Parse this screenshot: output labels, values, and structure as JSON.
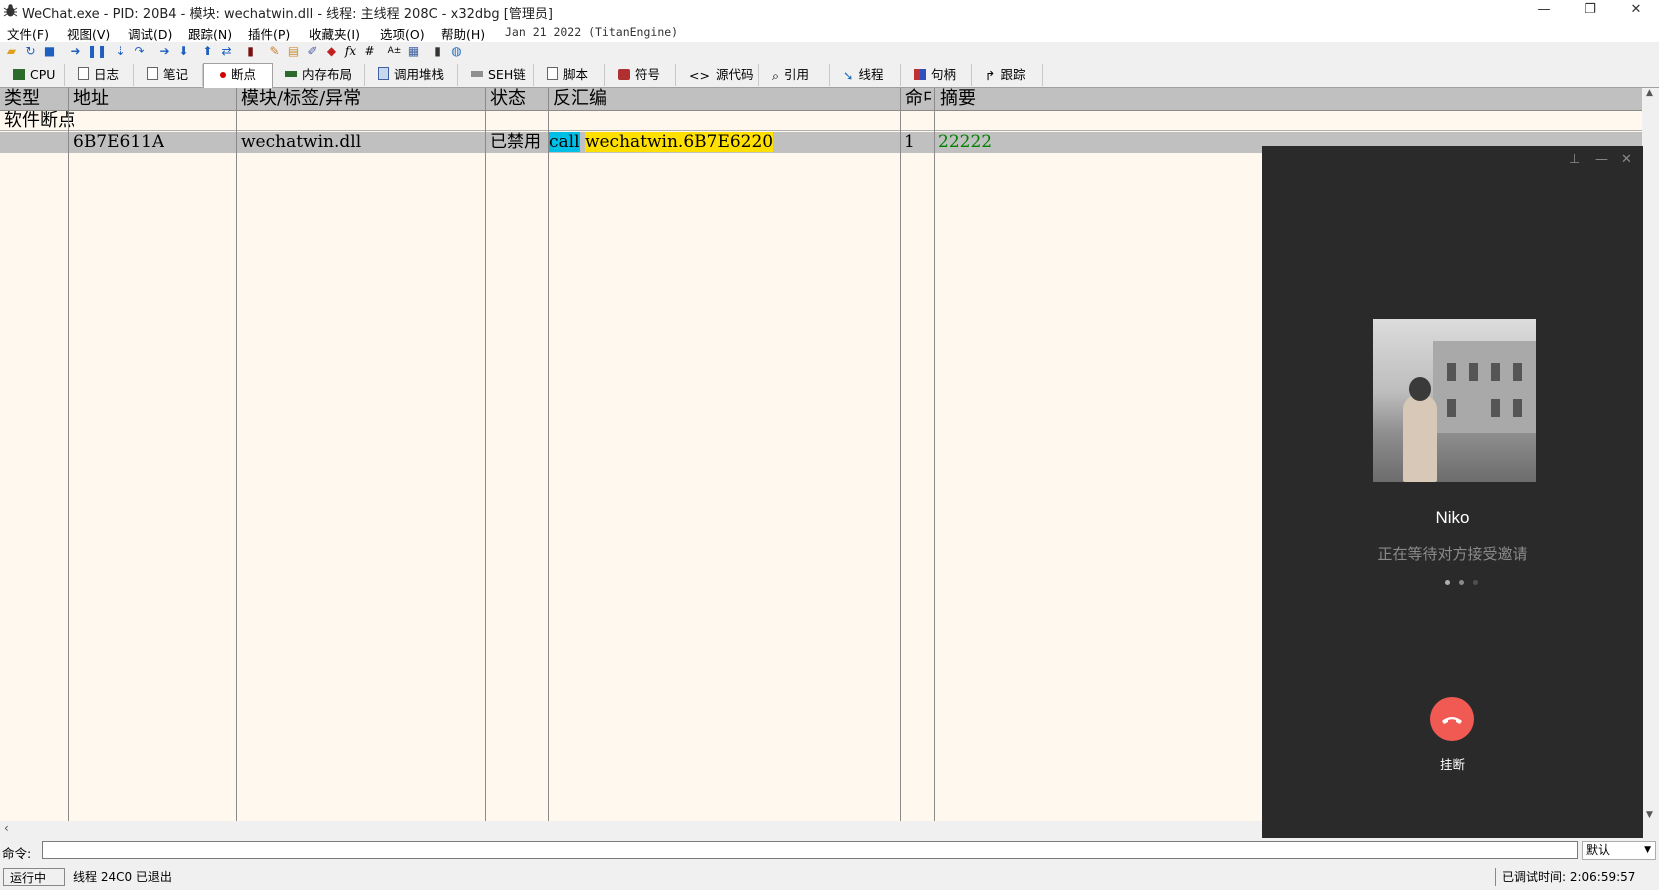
{
  "window": {
    "title": "WeChat.exe - PID: 20B4 - 模块: wechatwin.dll - 线程: 主线程 208C - x32dbg [管理员]",
    "minimize": "—",
    "restore": "❐",
    "close": "✕"
  },
  "menu": {
    "items": [
      "文件(F)",
      "视图(V)",
      "调试(D)",
      "跟踪(N)",
      "插件(P)",
      "收藏夹(I)",
      "选项(O)",
      "帮助(H)"
    ],
    "date": "Jan 21 2022 (TitanEngine)"
  },
  "toolbar": {
    "icons": [
      "open-icon",
      "restart-icon",
      "stop-icon",
      "run-icon",
      "pause-icon",
      "step-into-icon",
      "step-over-icon",
      "trace-into-icon",
      "trace-over-icon",
      "execute-till-return-icon",
      "run-to-user-code-icon",
      "scylla-icon",
      "patch-icon",
      "comment-icon",
      "label-icon",
      "bookmark-icon",
      "function-icon",
      "hash-icon",
      "font-icon",
      "calculator-icon",
      "globe-icon"
    ]
  },
  "tabs": [
    {
      "label": "CPU"
    },
    {
      "label": "日志"
    },
    {
      "label": "笔记"
    },
    {
      "label": "断点"
    },
    {
      "label": "内存布局"
    },
    {
      "label": "调用堆栈"
    },
    {
      "label": "SEH链"
    },
    {
      "label": "脚本"
    },
    {
      "label": "符号"
    },
    {
      "label": "源代码"
    },
    {
      "label": "引用"
    },
    {
      "label": "线程"
    },
    {
      "label": "句柄"
    },
    {
      "label": "跟踪"
    }
  ],
  "table": {
    "headers": [
      "类型",
      "地址",
      "模块/标签/异常",
      "状态",
      "反汇编",
      "命中",
      "摘要"
    ],
    "group": "软件断点",
    "row": {
      "address": "6B7E611A",
      "module": "wechatwin.dll",
      "state": "已禁用",
      "disasm_op": "call",
      "disasm_target": "wechatwin.6B7E6220",
      "hits": "1",
      "summary": "22222"
    }
  },
  "command": {
    "label": "命令:",
    "value": "",
    "mode": "默认"
  },
  "status": {
    "state": "运行中",
    "message": "线程 24C0 已退出",
    "elapsed": "已调试时间: 2:06:59:57"
  },
  "call_window": {
    "pin": "⊥",
    "minimize": "—",
    "close": "✕",
    "contact_name": "Niko",
    "status": "正在等待对方接受邀请",
    "hangup_label": "挂断",
    "colors": {
      "background": "#2a2a2a",
      "hangup": "#f05a52"
    }
  }
}
